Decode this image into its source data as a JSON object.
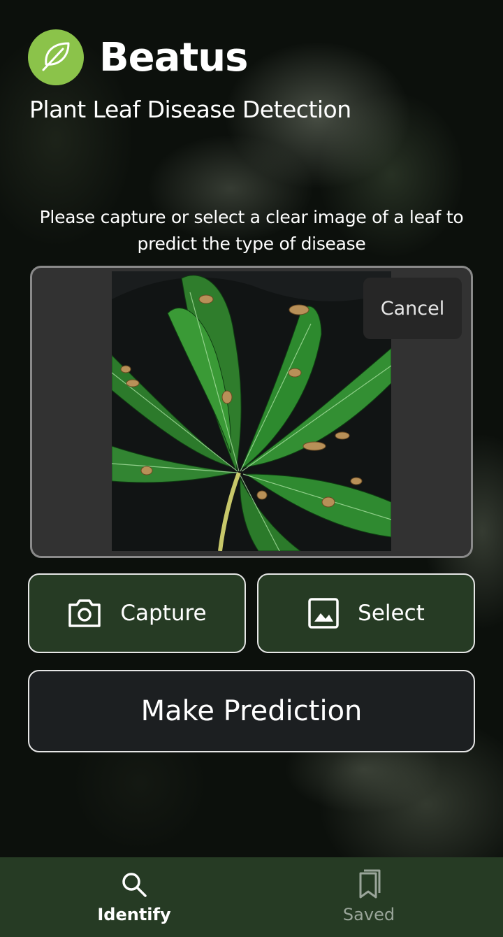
{
  "app": {
    "title": "Beatus",
    "subtitle": "Plant Leaf Disease Detection",
    "logo_icon": "leaf-icon",
    "accent": "#8bc34a",
    "brand_green": "#263b24"
  },
  "main": {
    "instructions": "Please capture or select a clear image of a leaf to predict the type of disease",
    "preview": {
      "cancel_label": "Cancel"
    },
    "actions": {
      "capture_label": "Capture",
      "capture_icon": "camera-icon",
      "select_label": "Select",
      "select_icon": "image-icon",
      "predict_label": "Make Prediction"
    }
  },
  "bottom_nav": {
    "items": [
      {
        "label": "Identify",
        "icon": "search-icon",
        "active": true
      },
      {
        "label": "Saved",
        "icon": "bookmark-icon",
        "active": false
      }
    ]
  }
}
